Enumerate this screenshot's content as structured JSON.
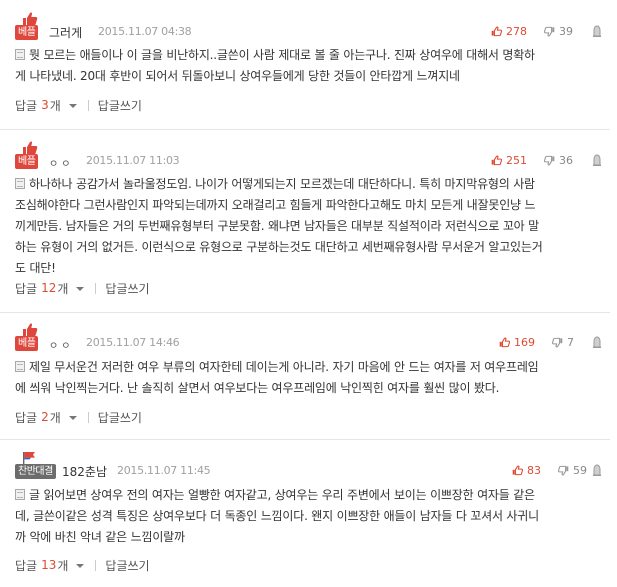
{
  "colors": {
    "accent_red": "#e04a33",
    "badge_best": "#e0473c",
    "badge_gray": "#6c6c6c",
    "muted": "#a0a0a0"
  },
  "comments": [
    {
      "badge": "베플",
      "badge_icon": "thumbs-up-icon",
      "author": "그러게",
      "date": "2015.11.07 04:38",
      "likes": "278",
      "dislikes": "39",
      "lines": [
        "뭣 모르는 애들이나 이 글을 비난하지..글쓴이 사람 제대로 볼 줄 아는구나. 진짜 상여우에 대해서 명확하",
        "게 나타냈네. 20대 후반이 되어서 뒤돌아보니 상여우들에게 당한 것들이 안타깝게 느껴지네"
      ],
      "reply_label": "답글",
      "reply_count": "3",
      "reply_unit": "개",
      "write_label": "답글쓰기"
    },
    {
      "badge": "베플",
      "badge_icon": "thumbs-up-icon",
      "author": "ㅇㅇ",
      "date": "2015.11.07 11:03",
      "likes": "251",
      "dislikes": "36",
      "lines": [
        "하나하나 공감가서 놀라울정도임. 나이가 어떻게되는지 모르겠는데 대단하다니. 특히 마지막유형의 사람",
        "조심해야한다 그런사람인지 파악되는데까지 오래걸리고 힘들게 파악한다고해도 마치 모든게 내잘못인냥 느",
        "끼게만듬. 남자들은 거의 두번째유형부터 구분못함. 왜냐면 남자들은 대부분 직설적이라 저런식으로 꼬아 말",
        "하는 유형이 거의 없거든. 이런식으로 유형으로 구분하는것도 대단하고 세번째유형사람 무서운거 알고있는거",
        "도 대단!"
      ],
      "reply_label": "답글",
      "reply_count": "12",
      "reply_unit": "개",
      "write_label": "답글쓰기"
    },
    {
      "badge": "베플",
      "badge_icon": "thumbs-up-icon",
      "author": "ㅇㅇ",
      "date": "2015.11.07 14:46",
      "likes": "169",
      "dislikes": "7",
      "lines": [
        "제일 무서운건 저러한 여우 부류의 여자한테 데이는게 아니라. 자기 마음에 안 드는 여자를 저 여우프레임",
        "에 씌워 낙인찍는거다. 난 솔직히 살면서 여우보다는 여우프레임에 낙인찍힌 여자를 훨씬 많이 봤다."
      ],
      "reply_label": "답글",
      "reply_count": "2",
      "reply_unit": "개",
      "write_label": "답글쓰기"
    },
    {
      "badge": "찬반대결",
      "badge_icon": "flag-icon",
      "author": "182춘남",
      "date": "2015.11.07 11:45",
      "likes": "83",
      "dislikes": "59",
      "lines": [
        "글 읽어보면 상여우 전의 여자는 얼빵한 여자같고, 상여우는 우리 주변에서 보이는 이쁘장한 여자들 같은",
        "데, 글쓴이같은 성격 특징은 상여우보다 더 독종인 느낌이다. 왠지 이쁘장한 애들이 남자들 다 꼬셔서 사귀니",
        "까 악에 바친 악녀 같은 느낌이랄까"
      ],
      "reply_label": "답글",
      "reply_count": "13",
      "reply_unit": "개",
      "write_label": "답글쓰기"
    }
  ]
}
